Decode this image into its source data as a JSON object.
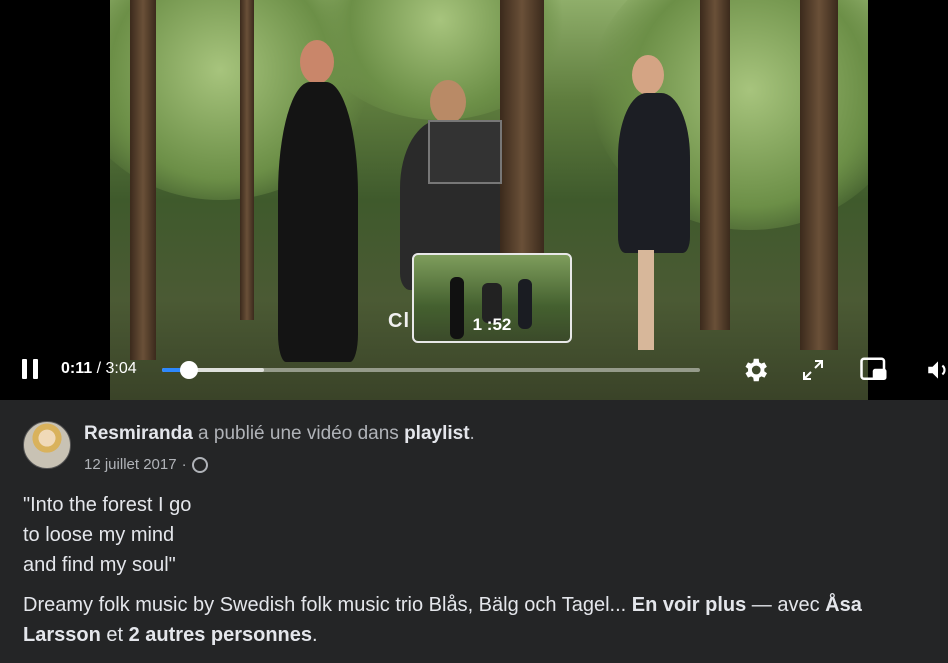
{
  "video": {
    "overlay_caption": "Cl                               ir",
    "preview_time": "1 :52",
    "current_time": "0:11",
    "separator": " / ",
    "duration": "3:04",
    "progress": 0.05,
    "buffered": 0.19
  },
  "icons": {
    "pause": "pause-icon",
    "settings": "gear-icon",
    "fullscreen": "expand-icon",
    "pip": "picture-in-picture-icon",
    "volume": "volume-icon",
    "privacy": "globe-icon"
  },
  "post": {
    "author": "Resmiranda",
    "action_text": " a publié une vidéo dans ",
    "target": "playlist",
    "period": ".",
    "date": "12 juillet 2017",
    "dot": "·",
    "quote_lines": [
      "\"Into the forest I go",
      "to loose my mind",
      "and find my soul\""
    ],
    "desc_text": "Dreamy folk music by Swedish folk music trio Blås, Bälg och Tagel...",
    "see_more": "En voir plus",
    "with_text": " — avec ",
    "tag1": "Åsa Larsson",
    "and_text": " et ",
    "tag2": "2 autres personnes",
    "end": "."
  },
  "colors": {
    "accent": "#2d88ff",
    "background": "#242526",
    "text": "#e4e6eb",
    "muted": "#b0b3b8"
  }
}
